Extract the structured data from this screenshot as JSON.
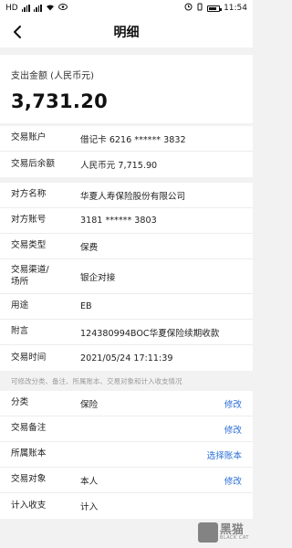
{
  "status_bar": {
    "carrier_left": "HD",
    "battery": "57",
    "time": "11:54"
  },
  "header": {
    "title": "明细"
  },
  "amount": {
    "label": "支出金额 (人民币元)",
    "value": "3,731.20"
  },
  "account_section": [
    {
      "key": "交易账户",
      "value": "借记卡 6216 ****** 3832"
    },
    {
      "key": "交易后余额",
      "value": "人民币元 7,715.90"
    }
  ],
  "detail_section": [
    {
      "key": "对方名称",
      "value": "华夏人寿保险股份有限公司"
    },
    {
      "key": "对方账号",
      "value": "3181 ****** 3803"
    },
    {
      "key": "交易类型",
      "value": "保费"
    },
    {
      "key": "交易渠道/场所",
      "value": "银企对接"
    },
    {
      "key": "用途",
      "value": "EB"
    },
    {
      "key": "附言",
      "value": "124380994BOC华夏保险续期收款"
    },
    {
      "key": "交易时间",
      "value": "2021/05/24 17:11:39"
    }
  ],
  "hint": "可修改分类、备注、所属账本、交易对象和计入收支情况",
  "edit_section": [
    {
      "key": "分类",
      "value": "保险",
      "action": "修改"
    },
    {
      "key": "交易备注",
      "value": "",
      "action": "修改"
    },
    {
      "key": "所属账本",
      "value": "",
      "action": "选择账本"
    },
    {
      "key": "交易对象",
      "value": "本人",
      "action": "修改"
    },
    {
      "key": "计入收支",
      "value": "计入",
      "action": ""
    }
  ],
  "watermark": {
    "cn": "黑猫",
    "en": "BLACK CAT"
  },
  "colors": {
    "link": "#2b6fd6",
    "background": "#f2f2f2"
  }
}
